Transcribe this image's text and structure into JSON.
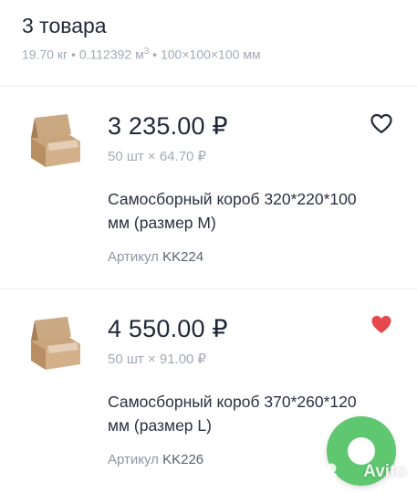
{
  "header": {
    "title": "3 товара",
    "weight": "19.70 кг",
    "volume": "0.112392 м",
    "volume_exp": "3",
    "dimensions": "100×100×100 мм",
    "separator": "•"
  },
  "items": [
    {
      "price": "3 235.00 ₽",
      "qty": "50 шт × 64.70 ₽",
      "name_line1": "Самосборный короб 320*220*100",
      "name_line2": "мм (размер M)",
      "sku_label": "Артикул",
      "sku_code": "KK224",
      "favorited": false,
      "image": "box-icon",
      "heart_icon": "heart-outline-icon"
    },
    {
      "price": "4 550.00 ₽",
      "qty": "50 шт × 91.00 ₽",
      "name_line1": "Самосборный короб 370*260*120",
      "name_line2": "мм (размер L)",
      "sku_label": "Артикул",
      "sku_code": "KK226",
      "favorited": true,
      "image": "box-icon",
      "heart_icon": "heart-filled-icon"
    }
  ],
  "fab": {
    "icon": "chat-icon"
  },
  "watermark": {
    "text": "Avito"
  },
  "colors": {
    "heart_filled": "#e5484d",
    "fab": "#5ec76f",
    "text_primary": "#1f2837",
    "text_secondary": "#a3aab5"
  }
}
